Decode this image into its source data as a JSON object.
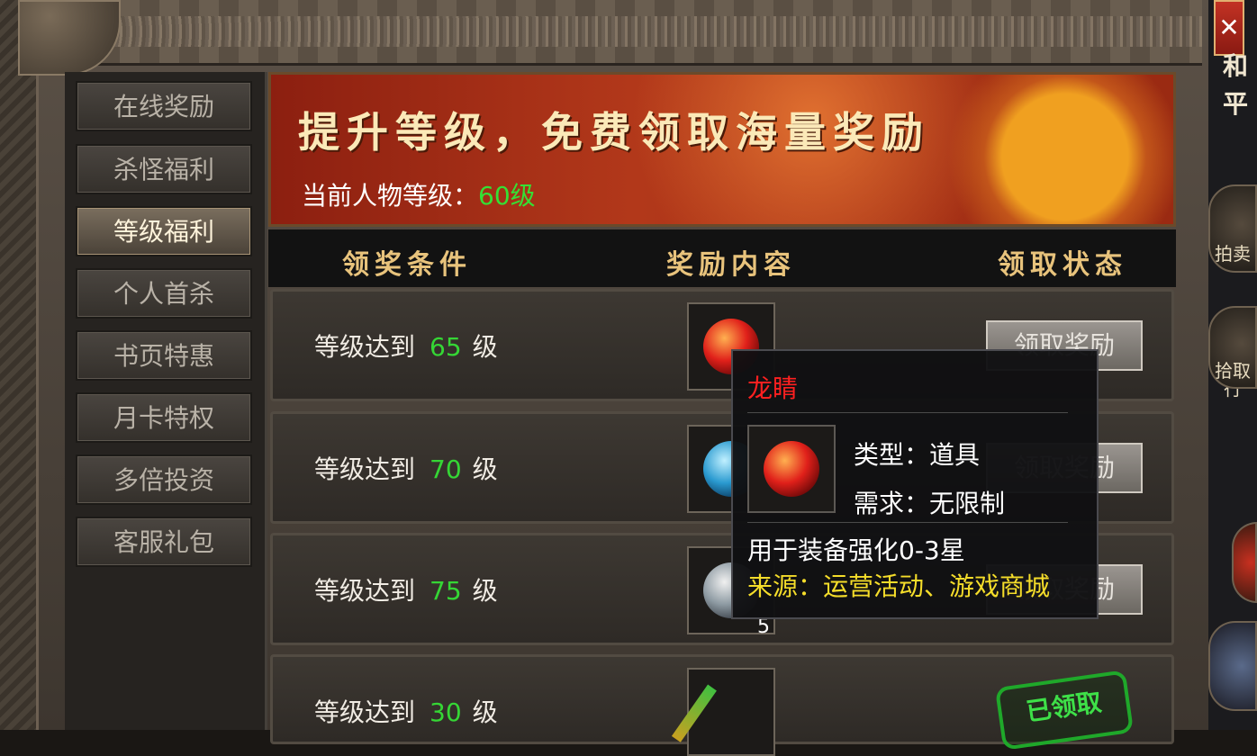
{
  "window": {
    "close_label": "✕",
    "side_chars": [
      "和",
      "平"
    ],
    "side_buttons": [
      {
        "name": "auction",
        "label": "拍卖行"
      },
      {
        "name": "pickup",
        "label": "拾取"
      }
    ]
  },
  "menu": {
    "items": [
      {
        "label": "在线奖励",
        "active": false
      },
      {
        "label": "杀怪福利",
        "active": false
      },
      {
        "label": "等级福利",
        "active": true
      },
      {
        "label": "个人首杀",
        "active": false
      },
      {
        "label": "书页特惠",
        "active": false
      },
      {
        "label": "月卡特权",
        "active": false
      },
      {
        "label": "多倍投资",
        "active": false
      },
      {
        "label": "客服礼包",
        "active": false
      }
    ]
  },
  "banner": {
    "title": "提升等级，免费领取海量奖励",
    "level_label": "当前人物等级：",
    "level_value": "60级"
  },
  "table": {
    "headers": [
      "领奖条件",
      "奖励内容",
      "领取状态"
    ],
    "rows": [
      {
        "prefix": "等级达到",
        "level": "65",
        "suffix": "级",
        "reward_icon": "dragon-eye-orb",
        "status": "领取奖励"
      },
      {
        "prefix": "等级达到",
        "level": "70",
        "suffix": "级",
        "reward_icon": "blue-orb",
        "status": "领取奖励"
      },
      {
        "prefix": "等级达到",
        "level": "75",
        "suffix": "级",
        "reward_icon": "grey-orb",
        "status": "领取奖励",
        "count": "5"
      },
      {
        "prefix": "等级达到",
        "level": "30",
        "suffix": "级",
        "reward_icon": "staff",
        "status": "已领取"
      }
    ]
  },
  "tooltip": {
    "name": "龙睛",
    "type_line": "类型：道具",
    "req_line": "需求：无限制",
    "desc": "用于装备强化0-3星",
    "source": "来源：运营活动、游戏商城"
  }
}
